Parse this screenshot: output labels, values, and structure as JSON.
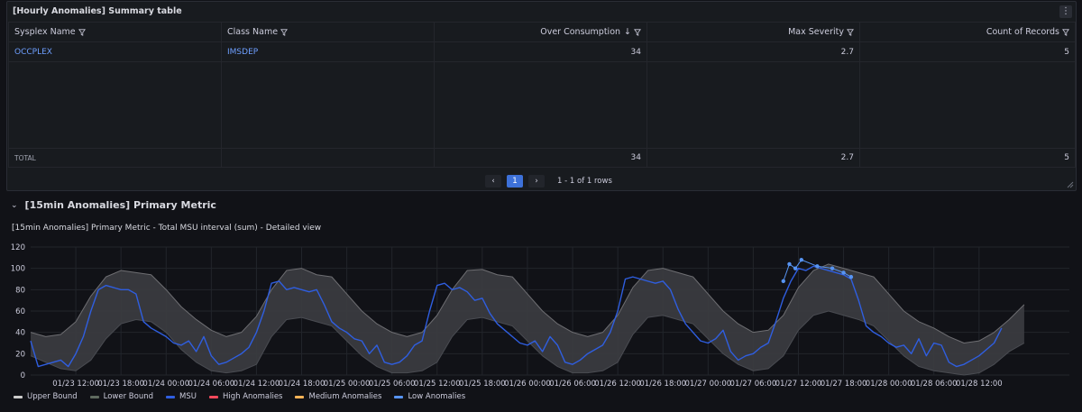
{
  "table_panel": {
    "title": "[Hourly Anomalies] Summary table",
    "columns": [
      "Sysplex Name",
      "Class Name",
      "Over Consumption",
      "Max Severity",
      "Count of Records"
    ],
    "rows": [
      {
        "sysplex": "OCCPLEX",
        "class": "IMSDEP",
        "over": "34",
        "sev": "2.7",
        "count": "5"
      }
    ],
    "total": {
      "label": "TOTAL",
      "over": "34",
      "sev": "2.7",
      "count": "5"
    },
    "pagination": {
      "prev": "‹",
      "page": "1",
      "next": "›",
      "info": "1 - 1 of 1 rows"
    }
  },
  "row": {
    "title": "[15min Anomalies] Primary Metric"
  },
  "chart_panel": {
    "title": "[15min Anomalies] Primary Metric - Total MSU interval (sum) - Detailed view"
  },
  "colors": {
    "upper": "#cccccc",
    "lower": "#5f6a5f",
    "msu": "#2f5ee0",
    "high": "#f2495c",
    "medium": "#ffb357",
    "low": "#5794f2"
  },
  "chart_data": {
    "type": "line",
    "title": "[15min Anomalies] Primary Metric - Total MSU interval (sum) - Detailed view",
    "ylim": [
      0,
      120
    ],
    "yticks": [
      "0",
      "20",
      "40",
      "60",
      "80",
      "100",
      "120"
    ],
    "xlim": [
      0,
      138
    ],
    "x_unit": "hours from 01/23 06:00",
    "xticks": [
      {
        "x": 6,
        "label": "01/23 12:00"
      },
      {
        "x": 12,
        "label": "01/23 18:00"
      },
      {
        "x": 18,
        "label": "01/24 00:00"
      },
      {
        "x": 24,
        "label": "01/24 06:00"
      },
      {
        "x": 30,
        "label": "01/24 12:00"
      },
      {
        "x": 36,
        "label": "01/24 18:00"
      },
      {
        "x": 42,
        "label": "01/25 00:00"
      },
      {
        "x": 48,
        "label": "01/25 06:00"
      },
      {
        "x": 54,
        "label": "01/25 12:00"
      },
      {
        "x": 60,
        "label": "01/25 18:00"
      },
      {
        "x": 66,
        "label": "01/26 00:00"
      },
      {
        "x": 72,
        "label": "01/26 06:00"
      },
      {
        "x": 78,
        "label": "01/26 12:00"
      },
      {
        "x": 84,
        "label": "01/26 18:00"
      },
      {
        "x": 90,
        "label": "01/27 00:00"
      },
      {
        "x": 96,
        "label": "01/27 06:00"
      },
      {
        "x": 102,
        "label": "01/27 12:00"
      },
      {
        "x": 108,
        "label": "01/27 18:00"
      },
      {
        "x": 114,
        "label": "01/28 00:00"
      },
      {
        "x": 120,
        "label": "01/28 06:00"
      },
      {
        "x": 126,
        "label": "01/28 12:00"
      }
    ],
    "series": [
      {
        "name": "Upper Bound",
        "color": "#cccccc",
        "points": [
          [
            0,
            40
          ],
          [
            2,
            36
          ],
          [
            4,
            38
          ],
          [
            6,
            50
          ],
          [
            8,
            74
          ],
          [
            10,
            92
          ],
          [
            12,
            98
          ],
          [
            14,
            96
          ],
          [
            16,
            94
          ],
          [
            18,
            80
          ],
          [
            20,
            64
          ],
          [
            22,
            52
          ],
          [
            24,
            42
          ],
          [
            26,
            36
          ],
          [
            28,
            40
          ],
          [
            30,
            55
          ],
          [
            32,
            80
          ],
          [
            34,
            98
          ],
          [
            36,
            100
          ],
          [
            38,
            94
          ],
          [
            40,
            92
          ],
          [
            42,
            76
          ],
          [
            44,
            60
          ],
          [
            46,
            48
          ],
          [
            48,
            40
          ],
          [
            50,
            36
          ],
          [
            52,
            40
          ],
          [
            54,
            56
          ],
          [
            56,
            80
          ],
          [
            58,
            98
          ],
          [
            60,
            99
          ],
          [
            62,
            94
          ],
          [
            64,
            92
          ],
          [
            66,
            76
          ],
          [
            68,
            60
          ],
          [
            70,
            48
          ],
          [
            72,
            40
          ],
          [
            74,
            36
          ],
          [
            76,
            40
          ],
          [
            78,
            56
          ],
          [
            80,
            82
          ],
          [
            82,
            98
          ],
          [
            84,
            100
          ],
          [
            86,
            96
          ],
          [
            88,
            92
          ],
          [
            90,
            76
          ],
          [
            92,
            60
          ],
          [
            94,
            48
          ],
          [
            96,
            40
          ],
          [
            98,
            42
          ],
          [
            100,
            56
          ],
          [
            102,
            82
          ],
          [
            104,
            98
          ],
          [
            106,
            104
          ],
          [
            108,
            100
          ],
          [
            110,
            96
          ],
          [
            112,
            92
          ],
          [
            114,
            76
          ],
          [
            116,
            60
          ],
          [
            118,
            50
          ],
          [
            120,
            44
          ],
          [
            122,
            36
          ],
          [
            124,
            30
          ],
          [
            126,
            32
          ],
          [
            128,
            40
          ],
          [
            130,
            52
          ],
          [
            132,
            66
          ]
        ]
      },
      {
        "name": "Lower Bound",
        "color": "#5f6a5f",
        "points": [
          [
            0,
            18
          ],
          [
            2,
            12
          ],
          [
            4,
            6
          ],
          [
            6,
            4
          ],
          [
            8,
            14
          ],
          [
            10,
            34
          ],
          [
            12,
            48
          ],
          [
            14,
            52
          ],
          [
            16,
            50
          ],
          [
            18,
            40
          ],
          [
            20,
            24
          ],
          [
            22,
            12
          ],
          [
            24,
            4
          ],
          [
            26,
            2
          ],
          [
            28,
            4
          ],
          [
            30,
            10
          ],
          [
            32,
            36
          ],
          [
            34,
            52
          ],
          [
            36,
            54
          ],
          [
            38,
            50
          ],
          [
            40,
            46
          ],
          [
            42,
            32
          ],
          [
            44,
            18
          ],
          [
            46,
            8
          ],
          [
            48,
            2
          ],
          [
            50,
            2
          ],
          [
            52,
            4
          ],
          [
            54,
            12
          ],
          [
            56,
            36
          ],
          [
            58,
            52
          ],
          [
            60,
            54
          ],
          [
            62,
            50
          ],
          [
            64,
            46
          ],
          [
            66,
            32
          ],
          [
            68,
            18
          ],
          [
            70,
            8
          ],
          [
            72,
            2
          ],
          [
            74,
            2
          ],
          [
            76,
            4
          ],
          [
            78,
            12
          ],
          [
            80,
            38
          ],
          [
            82,
            54
          ],
          [
            84,
            56
          ],
          [
            86,
            52
          ],
          [
            88,
            48
          ],
          [
            90,
            34
          ],
          [
            92,
            20
          ],
          [
            94,
            10
          ],
          [
            96,
            4
          ],
          [
            98,
            6
          ],
          [
            100,
            18
          ],
          [
            102,
            42
          ],
          [
            104,
            56
          ],
          [
            106,
            60
          ],
          [
            108,
            56
          ],
          [
            110,
            52
          ],
          [
            112,
            46
          ],
          [
            114,
            32
          ],
          [
            116,
            18
          ],
          [
            118,
            8
          ],
          [
            120,
            4
          ],
          [
            122,
            2
          ],
          [
            124,
            0
          ],
          [
            126,
            2
          ],
          [
            128,
            10
          ],
          [
            130,
            22
          ],
          [
            132,
            30
          ]
        ]
      },
      {
        "name": "MSU",
        "color": "#2f5ee0",
        "points": [
          [
            0,
            32
          ],
          [
            1,
            8
          ],
          [
            2,
            10
          ],
          [
            3,
            12
          ],
          [
            4,
            14
          ],
          [
            5,
            8
          ],
          [
            6,
            20
          ],
          [
            7,
            36
          ],
          [
            8,
            60
          ],
          [
            9,
            80
          ],
          [
            10,
            84
          ],
          [
            11,
            82
          ],
          [
            12,
            80
          ],
          [
            13,
            80
          ],
          [
            14,
            76
          ],
          [
            15,
            50
          ],
          [
            16,
            44
          ],
          [
            17,
            40
          ],
          [
            18,
            36
          ],
          [
            19,
            30
          ],
          [
            20,
            28
          ],
          [
            21,
            32
          ],
          [
            22,
            22
          ],
          [
            23,
            36
          ],
          [
            24,
            18
          ],
          [
            25,
            10
          ],
          [
            26,
            12
          ],
          [
            27,
            16
          ],
          [
            28,
            20
          ],
          [
            29,
            26
          ],
          [
            30,
            40
          ],
          [
            31,
            60
          ],
          [
            32,
            86
          ],
          [
            33,
            88
          ],
          [
            34,
            80
          ],
          [
            35,
            82
          ],
          [
            36,
            80
          ],
          [
            37,
            78
          ],
          [
            38,
            80
          ],
          [
            39,
            66
          ],
          [
            40,
            50
          ],
          [
            41,
            44
          ],
          [
            42,
            40
          ],
          [
            43,
            34
          ],
          [
            44,
            32
          ],
          [
            45,
            20
          ],
          [
            46,
            28
          ],
          [
            47,
            12
          ],
          [
            48,
            10
          ],
          [
            49,
            12
          ],
          [
            50,
            18
          ],
          [
            51,
            28
          ],
          [
            52,
            32
          ],
          [
            53,
            60
          ],
          [
            54,
            84
          ],
          [
            55,
            86
          ],
          [
            56,
            80
          ],
          [
            57,
            82
          ],
          [
            58,
            78
          ],
          [
            59,
            70
          ],
          [
            60,
            72
          ],
          [
            61,
            58
          ],
          [
            62,
            48
          ],
          [
            63,
            42
          ],
          [
            64,
            36
          ],
          [
            65,
            30
          ],
          [
            66,
            28
          ],
          [
            67,
            32
          ],
          [
            68,
            22
          ],
          [
            69,
            36
          ],
          [
            70,
            28
          ],
          [
            71,
            12
          ],
          [
            72,
            10
          ],
          [
            73,
            14
          ],
          [
            74,
            20
          ],
          [
            75,
            24
          ],
          [
            76,
            28
          ],
          [
            77,
            40
          ],
          [
            78,
            60
          ],
          [
            79,
            90
          ],
          [
            80,
            92
          ],
          [
            81,
            90
          ],
          [
            82,
            88
          ],
          [
            83,
            86
          ],
          [
            84,
            88
          ],
          [
            85,
            80
          ],
          [
            86,
            62
          ],
          [
            87,
            48
          ],
          [
            88,
            40
          ],
          [
            89,
            32
          ],
          [
            90,
            30
          ],
          [
            91,
            34
          ],
          [
            92,
            42
          ],
          [
            93,
            22
          ],
          [
            94,
            14
          ],
          [
            95,
            18
          ],
          [
            96,
            20
          ],
          [
            97,
            26
          ],
          [
            98,
            30
          ],
          [
            99,
            50
          ],
          [
            100,
            72
          ],
          [
            101,
            88
          ],
          [
            102,
            100
          ],
          [
            103,
            98
          ],
          [
            104,
            102
          ],
          [
            105,
            100
          ],
          [
            106,
            98
          ],
          [
            107,
            96
          ],
          [
            108,
            94
          ],
          [
            109,
            90
          ],
          [
            110,
            70
          ],
          [
            111,
            46
          ],
          [
            112,
            40
          ],
          [
            113,
            36
          ],
          [
            114,
            30
          ],
          [
            115,
            26
          ],
          [
            116,
            28
          ],
          [
            117,
            20
          ],
          [
            118,
            34
          ],
          [
            119,
            18
          ],
          [
            120,
            30
          ],
          [
            121,
            28
          ],
          [
            122,
            12
          ],
          [
            123,
            8
          ],
          [
            124,
            10
          ],
          [
            125,
            14
          ],
          [
            126,
            18
          ],
          [
            127,
            24
          ],
          [
            128,
            30
          ],
          [
            129,
            44
          ]
        ]
      },
      {
        "name": "High Anomalies",
        "color": "#f2495c",
        "points": []
      },
      {
        "name": "Medium Anomalies",
        "color": "#ffb357",
        "points": []
      },
      {
        "name": "Low Anomalies",
        "color": "#5794f2",
        "points": [
          [
            100,
            88
          ],
          [
            100.8,
            104
          ],
          [
            101.6,
            100
          ],
          [
            102.4,
            108
          ],
          [
            104.5,
            102
          ],
          [
            106.5,
            100
          ],
          [
            108,
            96
          ],
          [
            109,
            92
          ]
        ]
      }
    ]
  },
  "legend": [
    "Upper Bound",
    "Lower Bound",
    "MSU",
    "High Anomalies",
    "Medium Anomalies",
    "Low Anomalies"
  ]
}
